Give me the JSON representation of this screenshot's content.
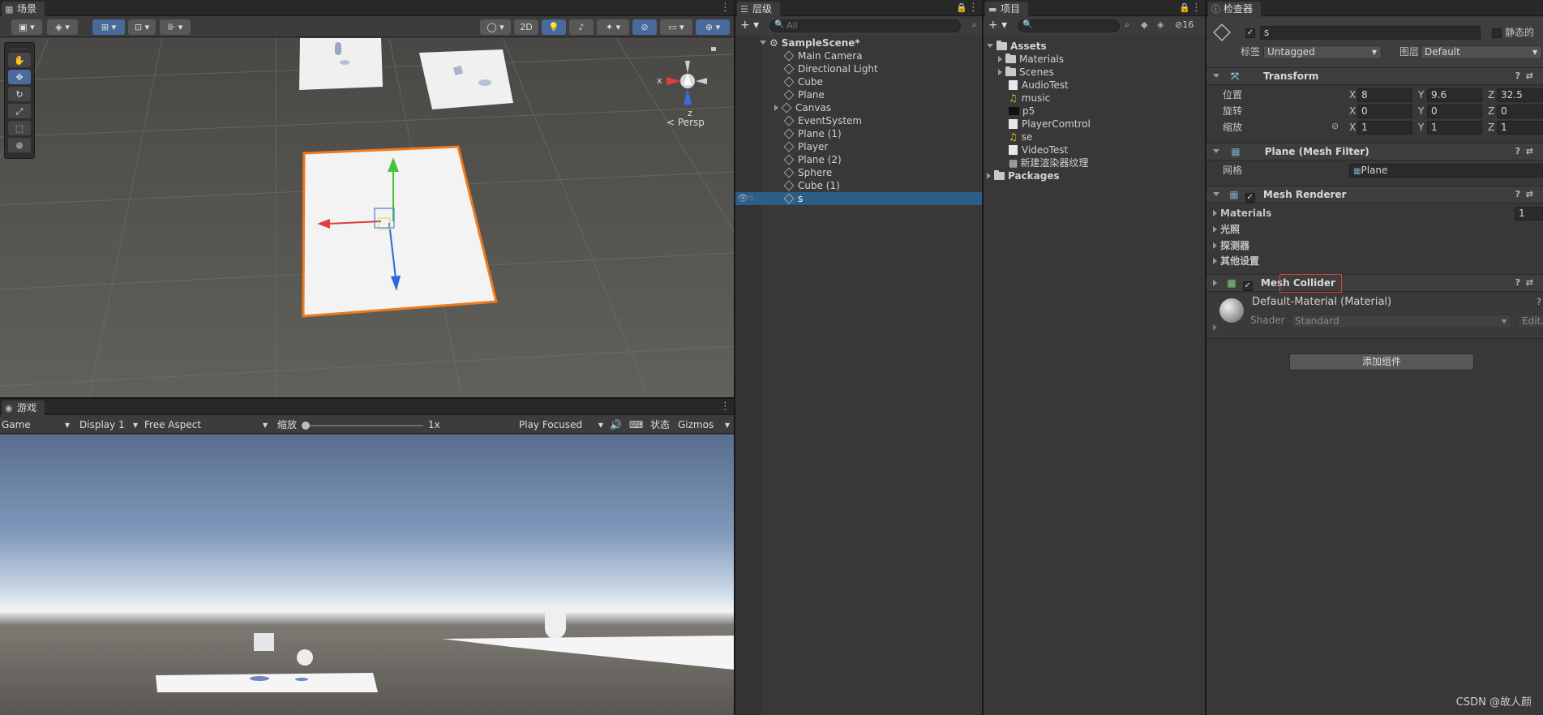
{
  "scene": {
    "tab": "场景",
    "toolbar": {
      "mode_2d": "2D"
    },
    "gizmo": {
      "x": "x",
      "z": "z",
      "persp": "< Persp"
    }
  },
  "game": {
    "tab": "游戏",
    "display_mode": "Game",
    "display": "Display 1",
    "aspect": "Free Aspect",
    "scale_label": "缩放",
    "scale_value": "1x",
    "play_mode": "Play Focused",
    "stats": "状态",
    "gizmos": "Gizmos"
  },
  "hierarchy": {
    "tab": "层级",
    "search_placeholder": "All",
    "scene_name": "SampleScene*",
    "items": [
      {
        "label": "Main Camera"
      },
      {
        "label": "Directional Light"
      },
      {
        "label": "Cube"
      },
      {
        "label": "Plane"
      },
      {
        "label": "Canvas"
      },
      {
        "label": "EventSystem"
      },
      {
        "label": "Plane (1)"
      },
      {
        "label": "Player"
      },
      {
        "label": "Plane (2)"
      },
      {
        "label": "Sphere"
      },
      {
        "label": "Cube (1)"
      },
      {
        "label": "s"
      }
    ]
  },
  "project": {
    "tab": "项目",
    "hidden_count": "16",
    "root": "Assets",
    "items": [
      {
        "label": "Materials",
        "icon": "folder-icon"
      },
      {
        "label": "Scenes",
        "icon": "folder-icon"
      },
      {
        "label": "AudioTest",
        "icon": "script-icon"
      },
      {
        "label": "music",
        "icon": "audio-icon"
      },
      {
        "label": "p5",
        "icon": "texture-icon"
      },
      {
        "label": "PlayerComtrol",
        "icon": "script-icon"
      },
      {
        "label": "se",
        "icon": "audio-icon"
      },
      {
        "label": "VideoTest",
        "icon": "script-icon"
      },
      {
        "label": "新建渲染器纹理",
        "icon": "render-texture-icon"
      }
    ],
    "packages": "Packages"
  },
  "inspector": {
    "tab": "检查器",
    "object_name": "s",
    "static_label": "静态的",
    "tag_label": "标签",
    "tag_value": "Untagged",
    "layer_label": "图层",
    "layer_value": "Default",
    "transform": {
      "title": "Transform",
      "position_label": "位置",
      "rotation_label": "旋转",
      "scale_label": "缩放",
      "position": {
        "x": "8",
        "y": "9.6",
        "z": "32.5"
      },
      "rotation": {
        "x": "0",
        "y": "0",
        "z": "0"
      },
      "scale": {
        "x": "1",
        "y": "1",
        "z": "1"
      },
      "axis_x": "X",
      "axis_y": "Y",
      "axis_z": "Z"
    },
    "mesh_filter": {
      "title": "Plane (Mesh Filter)",
      "mesh_label": "网格",
      "mesh_value": "Plane"
    },
    "mesh_renderer": {
      "title": "Mesh Renderer",
      "materials_label": "Materials",
      "materials_count": "1",
      "lighting": "光照",
      "probes": "探测器",
      "other": "其他设置"
    },
    "mesh_collider": {
      "title": "Mesh Collider"
    },
    "material": {
      "name": "Default-Material (Material)",
      "shader_label": "Shader",
      "shader_value": "Standard",
      "edit": "Edit..."
    },
    "add_component": "添加组件"
  },
  "watermark": "CSDN @故人颜",
  "colors": {
    "selection": "#2c5d87",
    "highlight_box": "#e23b3b",
    "plane_outline": "#f07a1e"
  }
}
